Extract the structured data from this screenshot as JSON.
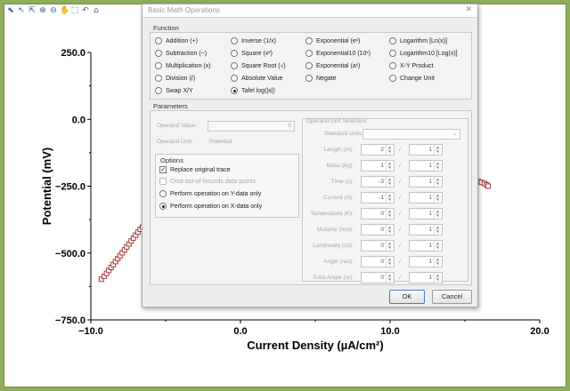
{
  "dialog": {
    "title": "Basic Math Operations",
    "close_glyph": "✕",
    "function_label": "Function",
    "functions": [
      {
        "label": "Addition (+)",
        "selected": false
      },
      {
        "label": "Inverse (1/x)",
        "selected": false
      },
      {
        "label": "Exponential (eˣ)",
        "selected": false
      },
      {
        "label": "Logarithm [Ln(x)]",
        "selected": false
      },
      {
        "label": "Subtraction (−)",
        "selected": false
      },
      {
        "label": "Square (x²)",
        "selected": false
      },
      {
        "label": "Exponential10 (10ˣ)",
        "selected": false
      },
      {
        "label": "Logarithm10 [Log(x)]",
        "selected": false
      },
      {
        "label": "Multiplication (x)",
        "selected": false
      },
      {
        "label": "Square Root (√)",
        "selected": false
      },
      {
        "label": "Exponential (aˣ)",
        "selected": false
      },
      {
        "label": "X-Y Product",
        "selected": false
      },
      {
        "label": "Division (/)",
        "selected": false
      },
      {
        "label": "Absolute Value",
        "selected": false
      },
      {
        "label": "Negate",
        "selected": false
      },
      {
        "label": "Change Unit",
        "selected": false
      },
      {
        "label": "Swap X/Y",
        "selected": false
      },
      {
        "label": "Tafel log(|x|)",
        "selected": true
      }
    ],
    "parameters": {
      "label": "Parameters",
      "operand_value_label": "Operand Value:",
      "operand_value": "0",
      "operand_unit_label": "Operand Unit:",
      "operand_unit": "Potential"
    },
    "options": {
      "label": "Options",
      "replace_original": {
        "label": "Replace original trace",
        "checked": true
      },
      "omit_out_of_bounds": {
        "label": "Omit out-of-bounds data points",
        "checked": false
      },
      "operate_y": {
        "label": "Perform operation on Y-data only",
        "selected": false
      },
      "operate_x": {
        "label": "Perform operation on X-data only",
        "selected": true
      }
    },
    "unit_selection": {
      "label": "Operand Unit Selection",
      "standard_units_label": "Standard units:",
      "standard_units_value": "",
      "rows": [
        {
          "label": "Length (m):",
          "num": "2",
          "den": "1"
        },
        {
          "label": "Mass (kg):",
          "num": "1",
          "den": "1"
        },
        {
          "label": "Time (s):",
          "num": "-3",
          "den": "1"
        },
        {
          "label": "Current (A):",
          "num": "-1",
          "den": "1"
        },
        {
          "label": "Temperature (K):",
          "num": "0",
          "den": "1"
        },
        {
          "label": "Molarity (mol):",
          "num": "0",
          "den": "1"
        },
        {
          "label": "Luminosity (cd):",
          "num": "0",
          "den": "1"
        },
        {
          "label": "Angle (rad):",
          "num": "0",
          "den": "1"
        },
        {
          "label": "Solid Angle (sr):",
          "num": "0",
          "den": "1"
        }
      ]
    },
    "ok_label": "OK",
    "cancel_label": "Cancel"
  },
  "toolbar_icons": [
    "select-arrow-icon",
    "cursor-icon",
    "point-cursor-icon",
    "zoom-in-icon",
    "zoom-out-icon",
    "pan-hand-icon",
    "zoom-box-icon",
    "undo-icon",
    "home-icon"
  ],
  "chart_data": {
    "type": "scatter",
    "xlabel": "Current Density (µA/cm²)",
    "ylabel": "Potential (mV)",
    "xlim": [
      -10.0,
      20.0
    ],
    "ylim": [
      -750.0,
      250.0
    ],
    "x_ticks": [
      "−10.0",
      "0.0",
      "10.0",
      "20.0"
    ],
    "y_ticks": [
      "250.0",
      "0.0",
      "−250.0",
      "−500.0",
      "−750.0"
    ],
    "grid": false,
    "marker_color": "#a33a3a",
    "series": [
      {
        "points": [
          [
            -9.3,
            -598
          ],
          [
            -9.1,
            -587
          ],
          [
            -8.95,
            -576
          ],
          [
            -8.8,
            -565
          ],
          [
            -8.65,
            -554
          ],
          [
            -8.5,
            -543
          ],
          [
            -8.35,
            -532
          ],
          [
            -8.2,
            -521
          ],
          [
            -8.05,
            -510
          ],
          [
            -7.9,
            -499
          ],
          [
            -7.75,
            -488
          ],
          [
            -7.6,
            -477
          ],
          [
            -7.45,
            -466
          ],
          [
            -7.3,
            -455
          ],
          [
            -7.15,
            -444
          ],
          [
            -7.0,
            -433
          ],
          [
            -6.85,
            -422
          ],
          [
            -6.7,
            -411
          ],
          [
            -6.55,
            -403
          ],
          [
            10.3,
            -230
          ],
          [
            10.5,
            -232
          ],
          [
            10.7,
            -233
          ],
          [
            10.9,
            -235
          ],
          [
            11.1,
            -236
          ],
          [
            11.3,
            -237
          ],
          [
            11.5,
            -238
          ],
          [
            11.7,
            -239
          ],
          [
            11.9,
            -240
          ],
          [
            12.1,
            -240
          ],
          [
            12.3,
            -241
          ],
          [
            12.5,
            -241
          ],
          [
            12.7,
            -241
          ],
          [
            12.9,
            -240
          ],
          [
            13.1,
            -240
          ],
          [
            13.3,
            -239
          ],
          [
            13.5,
            -238
          ],
          [
            13.7,
            -237
          ],
          [
            13.9,
            -236
          ],
          [
            14.1,
            -235
          ],
          [
            14.3,
            -234
          ],
          [
            14.5,
            -233
          ],
          [
            14.7,
            -232
          ],
          [
            14.9,
            -231
          ],
          [
            15.1,
            -231
          ],
          [
            15.3,
            -230
          ],
          [
            15.5,
            -230
          ],
          [
            15.7,
            -231
          ],
          [
            15.9,
            -233
          ],
          [
            16.1,
            -236
          ],
          [
            16.3,
            -240
          ],
          [
            16.45,
            -245
          ],
          [
            16.55,
            -250
          ]
        ]
      }
    ]
  }
}
